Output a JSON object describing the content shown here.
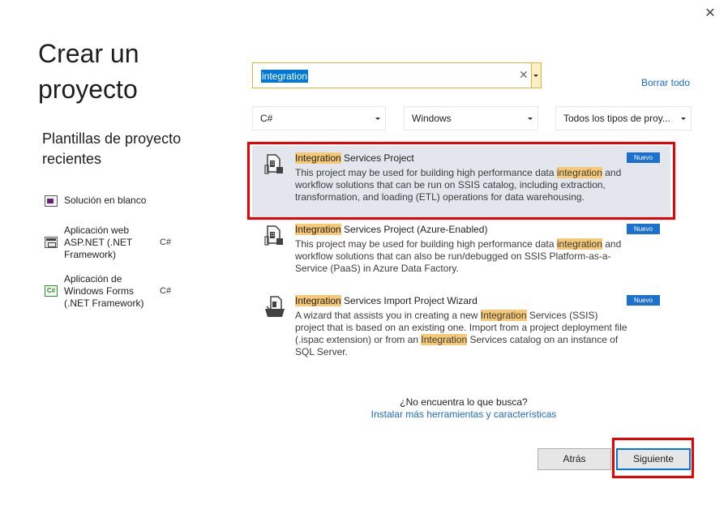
{
  "window": {
    "close_glyph": "✕"
  },
  "title": "Crear un proyecto",
  "recent": {
    "heading": "Plantillas de proyecto recientes",
    "items": [
      {
        "label": "Solución en blanco",
        "lang": "",
        "icon": "blank-solution-icon"
      },
      {
        "label": "Aplicación web ASP.NET (.NET Framework)",
        "lang": "C#",
        "icon": "web-app-icon"
      },
      {
        "label": "Aplicación de Windows Forms (.NET Framework)",
        "lang": "C#",
        "icon": "windows-forms-icon"
      }
    ]
  },
  "search": {
    "value": "integration",
    "clear_glyph": "✕",
    "clear_all_label": "Borrar todo"
  },
  "filters": {
    "language": "C#",
    "platform": "Windows",
    "project_type": "Todos los tipos de proy..."
  },
  "results": [
    {
      "title_highlight": "Integration",
      "title_rest": " Services Project",
      "desc_before": "This project may be used for building high performance data ",
      "desc_highlight": "integration",
      "desc_after": " and workflow solutions that can be run on SSIS catalog, including extraction, transformation, and loading (ETL) operations for data warehousing.",
      "badge": "Nuevo",
      "selected": true
    },
    {
      "title_highlight": "Integration",
      "title_rest": " Services Project (Azure-Enabled)",
      "desc_before": "This project may be used for building high performance data ",
      "desc_highlight": "integration",
      "desc_after": " and workflow solutions that can also be run/debugged on SSIS Platform-as-a-Service (PaaS) in Azure Data Factory.",
      "badge": "Nuevo",
      "selected": false
    },
    {
      "title_highlight": "Integration",
      "title_rest": " Services Import Project Wizard",
      "desc_part1": "A wizard that assists you in creating a new ",
      "desc_hl1": "Integration",
      "desc_part2": " Services (SSIS) project that is based on an existing one. Import from a project deployment file (.ispac extension) or from an ",
      "desc_hl2": "Integration",
      "desc_part3": " Services catalog on an instance of SQL Server.",
      "badge": "Nuevo",
      "selected": false
    }
  ],
  "not_found": {
    "question": "¿No encuentra lo que busca?",
    "link": "Instalar más herramientas y características"
  },
  "buttons": {
    "back": "Atrás",
    "next": "Siguiente"
  },
  "colors": {
    "accent": "#0078d7",
    "badge": "#1c70d0",
    "highlight": "#f6c977",
    "annotation": "#ef0000"
  }
}
